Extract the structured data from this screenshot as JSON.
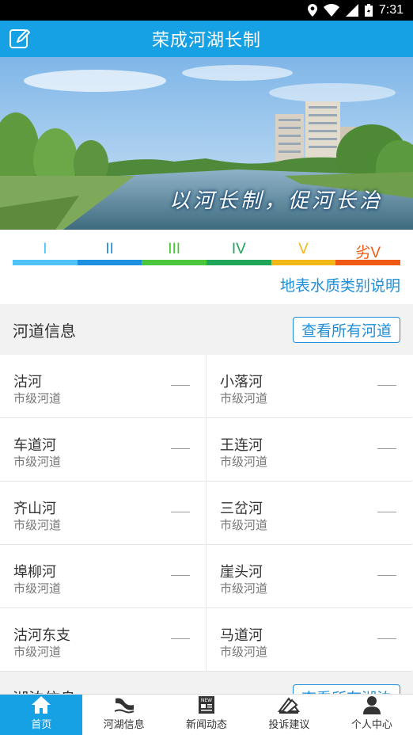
{
  "status_bar": {
    "time": "7:31"
  },
  "header": {
    "title": "荣成河湖长制",
    "edit_icon": "edit-icon"
  },
  "banner": {
    "motto": "以河长制，促河长治"
  },
  "water_grades": {
    "items": [
      {
        "label": "I",
        "color": "#4fc3f7"
      },
      {
        "label": "II",
        "color": "#1e90e0"
      },
      {
        "label": "III",
        "color": "#4cc63a"
      },
      {
        "label": "IV",
        "color": "#1fa65a"
      },
      {
        "label": "V",
        "color": "#f2b818"
      },
      {
        "label": "劣V",
        "color": "#f05a14"
      }
    ],
    "help_link": "地表水质类别说明"
  },
  "rivers_section": {
    "title": "河道信息",
    "view_all": "查看所有河道",
    "items": [
      {
        "name": "沽河",
        "level": "市级河道"
      },
      {
        "name": "小落河",
        "level": "市级河道"
      },
      {
        "name": "车道河",
        "level": "市级河道"
      },
      {
        "name": "王连河",
        "level": "市级河道"
      },
      {
        "name": "齐山河",
        "level": "市级河道"
      },
      {
        "name": "三岔河",
        "level": "市级河道"
      },
      {
        "name": "埠柳河",
        "level": "市级河道"
      },
      {
        "name": "崖头河",
        "level": "市级河道"
      },
      {
        "name": "沽河东支",
        "level": "市级河道"
      },
      {
        "name": "马道河",
        "level": "市级河道"
      }
    ]
  },
  "lakes_section": {
    "title": "湖泊信息",
    "view_all": "查看所有湖泊"
  },
  "tabbar": {
    "tabs": [
      {
        "label": "首页",
        "icon": "home-icon",
        "active": true
      },
      {
        "label": "河湖信息",
        "icon": "river-icon",
        "active": false
      },
      {
        "label": "新闻动态",
        "icon": "news-icon",
        "active": false
      },
      {
        "label": "投诉建议",
        "icon": "complaint-icon",
        "active": false
      },
      {
        "label": "个人中心",
        "icon": "user-icon",
        "active": false
      }
    ]
  }
}
